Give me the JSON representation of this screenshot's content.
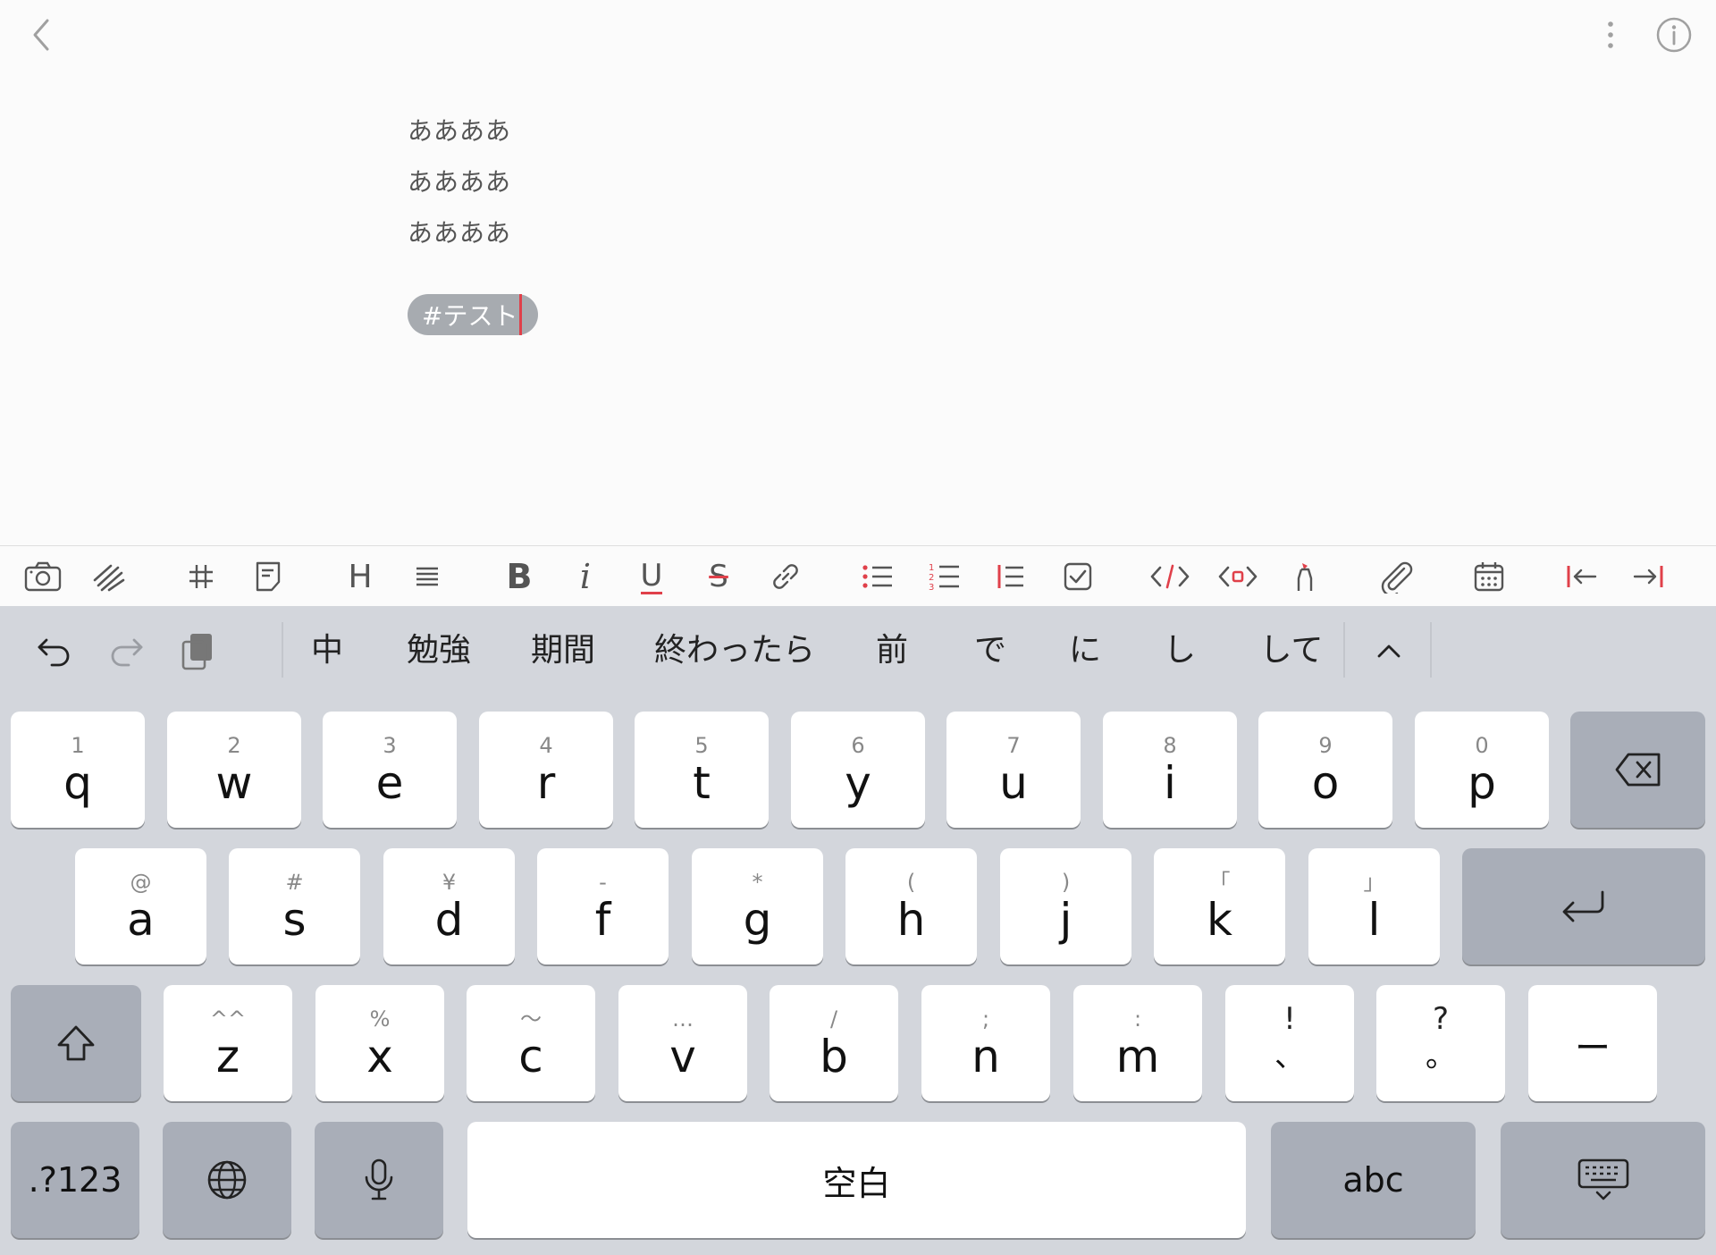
{
  "editor": {
    "lines": [
      "ああああ",
      "ああああ",
      "ああああ"
    ],
    "tag": "#テスト"
  },
  "icons": {
    "back": "chevron-left-icon",
    "more": "more-vertical-icon",
    "info": "info-icon"
  },
  "toolbar": {
    "items": [
      "camera-icon",
      "scribble-icon",
      "hashtag-icon",
      "note-icon",
      "heading-icon",
      "align-icon",
      "bold-icon",
      "italic-icon",
      "underline-icon",
      "strikethrough-icon",
      "link-icon",
      "bullet-list-icon",
      "numbered-list-icon",
      "quote-icon",
      "checkbox-icon",
      "code-icon",
      "code-block-icon",
      "highlight-icon",
      "attachment-icon",
      "calendar-icon",
      "outdent-icon",
      "indent-icon"
    ],
    "heading": "H",
    "bold": "B",
    "italic": "i",
    "underline": "U",
    "strike": "S"
  },
  "candidates": [
    "中",
    "勉強",
    "期間",
    "終わったら",
    "前",
    "で",
    "に",
    "し",
    "して"
  ],
  "keyboard": {
    "row1": [
      {
        "sub": "1",
        "main": "q"
      },
      {
        "sub": "2",
        "main": "w"
      },
      {
        "sub": "3",
        "main": "e"
      },
      {
        "sub": "4",
        "main": "r"
      },
      {
        "sub": "5",
        "main": "t"
      },
      {
        "sub": "6",
        "main": "y"
      },
      {
        "sub": "7",
        "main": "u"
      },
      {
        "sub": "8",
        "main": "i"
      },
      {
        "sub": "9",
        "main": "o"
      },
      {
        "sub": "0",
        "main": "p"
      }
    ],
    "row2": [
      {
        "sub": "@",
        "main": "a"
      },
      {
        "sub": "#",
        "main": "s"
      },
      {
        "sub": "¥",
        "main": "d"
      },
      {
        "sub": "-",
        "main": "f"
      },
      {
        "sub": "*",
        "main": "g"
      },
      {
        "sub": "(",
        "main": "h"
      },
      {
        "sub": ")",
        "main": "j"
      },
      {
        "sub": "「",
        "main": "k"
      },
      {
        "sub": "」",
        "main": "l"
      }
    ],
    "row3": [
      {
        "sub": "^^",
        "main": "z"
      },
      {
        "sub": "%",
        "main": "x"
      },
      {
        "sub": "〜",
        "main": "c"
      },
      {
        "sub": "…",
        "main": "v"
      },
      {
        "sub": "/",
        "main": "b"
      },
      {
        "sub": ";",
        "main": "n"
      },
      {
        "sub": ":",
        "main": "m"
      },
      {
        "sub": "!",
        "main": "、"
      },
      {
        "sub": "?",
        "main": "。"
      },
      {
        "sub": "",
        "main": "ー"
      }
    ],
    "numbers_label": ".?123",
    "space_label": "空白",
    "abc_label": "abc"
  }
}
